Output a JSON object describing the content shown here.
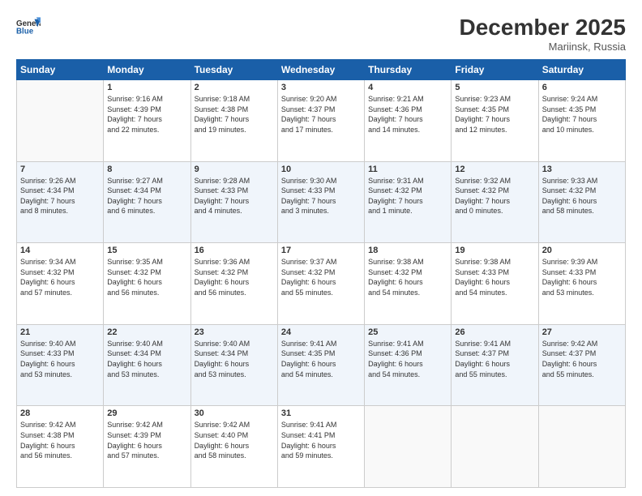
{
  "header": {
    "logo_line1": "General",
    "logo_line2": "Blue",
    "month": "December 2025",
    "location": "Mariinsk, Russia"
  },
  "days_of_week": [
    "Sunday",
    "Monday",
    "Tuesday",
    "Wednesday",
    "Thursday",
    "Friday",
    "Saturday"
  ],
  "weeks": [
    [
      {
        "day": "",
        "info": ""
      },
      {
        "day": "1",
        "info": "Sunrise: 9:16 AM\nSunset: 4:39 PM\nDaylight: 7 hours\nand 22 minutes."
      },
      {
        "day": "2",
        "info": "Sunrise: 9:18 AM\nSunset: 4:38 PM\nDaylight: 7 hours\nand 19 minutes."
      },
      {
        "day": "3",
        "info": "Sunrise: 9:20 AM\nSunset: 4:37 PM\nDaylight: 7 hours\nand 17 minutes."
      },
      {
        "day": "4",
        "info": "Sunrise: 9:21 AM\nSunset: 4:36 PM\nDaylight: 7 hours\nand 14 minutes."
      },
      {
        "day": "5",
        "info": "Sunrise: 9:23 AM\nSunset: 4:35 PM\nDaylight: 7 hours\nand 12 minutes."
      },
      {
        "day": "6",
        "info": "Sunrise: 9:24 AM\nSunset: 4:35 PM\nDaylight: 7 hours\nand 10 minutes."
      }
    ],
    [
      {
        "day": "7",
        "info": "Sunrise: 9:26 AM\nSunset: 4:34 PM\nDaylight: 7 hours\nand 8 minutes."
      },
      {
        "day": "8",
        "info": "Sunrise: 9:27 AM\nSunset: 4:34 PM\nDaylight: 7 hours\nand 6 minutes."
      },
      {
        "day": "9",
        "info": "Sunrise: 9:28 AM\nSunset: 4:33 PM\nDaylight: 7 hours\nand 4 minutes."
      },
      {
        "day": "10",
        "info": "Sunrise: 9:30 AM\nSunset: 4:33 PM\nDaylight: 7 hours\nand 3 minutes."
      },
      {
        "day": "11",
        "info": "Sunrise: 9:31 AM\nSunset: 4:32 PM\nDaylight: 7 hours\nand 1 minute."
      },
      {
        "day": "12",
        "info": "Sunrise: 9:32 AM\nSunset: 4:32 PM\nDaylight: 7 hours\nand 0 minutes."
      },
      {
        "day": "13",
        "info": "Sunrise: 9:33 AM\nSunset: 4:32 PM\nDaylight: 6 hours\nand 58 minutes."
      }
    ],
    [
      {
        "day": "14",
        "info": "Sunrise: 9:34 AM\nSunset: 4:32 PM\nDaylight: 6 hours\nand 57 minutes."
      },
      {
        "day": "15",
        "info": "Sunrise: 9:35 AM\nSunset: 4:32 PM\nDaylight: 6 hours\nand 56 minutes."
      },
      {
        "day": "16",
        "info": "Sunrise: 9:36 AM\nSunset: 4:32 PM\nDaylight: 6 hours\nand 56 minutes."
      },
      {
        "day": "17",
        "info": "Sunrise: 9:37 AM\nSunset: 4:32 PM\nDaylight: 6 hours\nand 55 minutes."
      },
      {
        "day": "18",
        "info": "Sunrise: 9:38 AM\nSunset: 4:32 PM\nDaylight: 6 hours\nand 54 minutes."
      },
      {
        "day": "19",
        "info": "Sunrise: 9:38 AM\nSunset: 4:33 PM\nDaylight: 6 hours\nand 54 minutes."
      },
      {
        "day": "20",
        "info": "Sunrise: 9:39 AM\nSunset: 4:33 PM\nDaylight: 6 hours\nand 53 minutes."
      }
    ],
    [
      {
        "day": "21",
        "info": "Sunrise: 9:40 AM\nSunset: 4:33 PM\nDaylight: 6 hours\nand 53 minutes."
      },
      {
        "day": "22",
        "info": "Sunrise: 9:40 AM\nSunset: 4:34 PM\nDaylight: 6 hours\nand 53 minutes."
      },
      {
        "day": "23",
        "info": "Sunrise: 9:40 AM\nSunset: 4:34 PM\nDaylight: 6 hours\nand 53 minutes."
      },
      {
        "day": "24",
        "info": "Sunrise: 9:41 AM\nSunset: 4:35 PM\nDaylight: 6 hours\nand 54 minutes."
      },
      {
        "day": "25",
        "info": "Sunrise: 9:41 AM\nSunset: 4:36 PM\nDaylight: 6 hours\nand 54 minutes."
      },
      {
        "day": "26",
        "info": "Sunrise: 9:41 AM\nSunset: 4:37 PM\nDaylight: 6 hours\nand 55 minutes."
      },
      {
        "day": "27",
        "info": "Sunrise: 9:42 AM\nSunset: 4:37 PM\nDaylight: 6 hours\nand 55 minutes."
      }
    ],
    [
      {
        "day": "28",
        "info": "Sunrise: 9:42 AM\nSunset: 4:38 PM\nDaylight: 6 hours\nand 56 minutes."
      },
      {
        "day": "29",
        "info": "Sunrise: 9:42 AM\nSunset: 4:39 PM\nDaylight: 6 hours\nand 57 minutes."
      },
      {
        "day": "30",
        "info": "Sunrise: 9:42 AM\nSunset: 4:40 PM\nDaylight: 6 hours\nand 58 minutes."
      },
      {
        "day": "31",
        "info": "Sunrise: 9:41 AM\nSunset: 4:41 PM\nDaylight: 6 hours\nand 59 minutes."
      },
      {
        "day": "",
        "info": ""
      },
      {
        "day": "",
        "info": ""
      },
      {
        "day": "",
        "info": ""
      }
    ]
  ]
}
